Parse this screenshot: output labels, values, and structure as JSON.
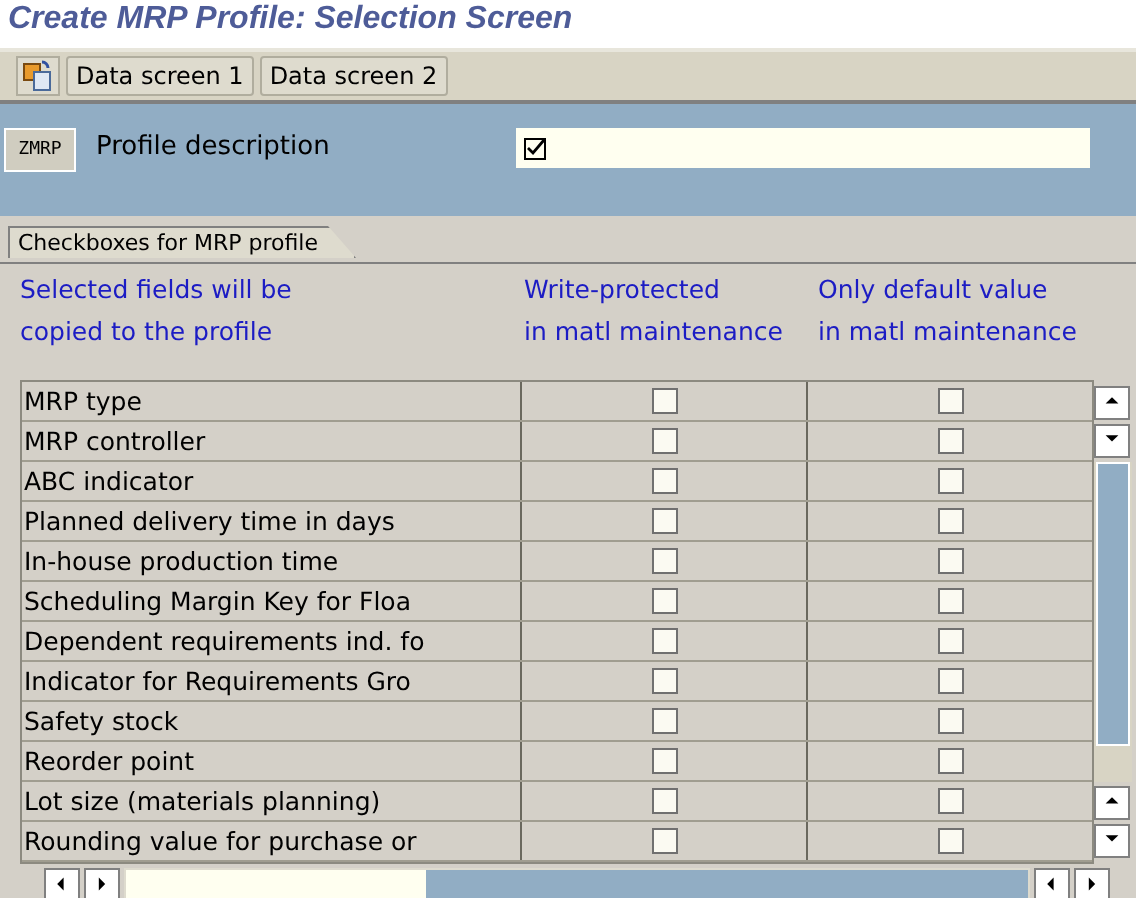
{
  "title": "Create MRP Profile: Selection Screen",
  "toolbar": {
    "buttons": [
      "Data screen 1",
      "Data screen 2"
    ]
  },
  "profile": {
    "code": "ZMRP",
    "label": "Profile description"
  },
  "tab": {
    "label": "Checkboxes for MRP profile",
    "selected": true
  },
  "headers": [
    {
      "line1": "Selected fields will be",
      "line2": "copied to the profile"
    },
    {
      "line1": "Write-protected",
      "line2": "in matl maintenance"
    },
    {
      "line1": "Only default value",
      "line2": "in matl maintenance"
    }
  ],
  "rows": [
    {
      "label": "MRP type",
      "write_protected": false,
      "default_only": false
    },
    {
      "label": "MRP controller",
      "write_protected": false,
      "default_only": false
    },
    {
      "label": "ABC indicator",
      "write_protected": false,
      "default_only": false
    },
    {
      "label": "Planned delivery time in days",
      "write_protected": false,
      "default_only": false
    },
    {
      "label": "In-house production time",
      "write_protected": false,
      "default_only": false
    },
    {
      "label": "Scheduling Margin Key for Floa",
      "write_protected": false,
      "default_only": false
    },
    {
      "label": "Dependent requirements ind. fo",
      "write_protected": false,
      "default_only": false
    },
    {
      "label": "Indicator for Requirements Gro",
      "write_protected": false,
      "default_only": false
    },
    {
      "label": "Safety stock",
      "write_protected": false,
      "default_only": false
    },
    {
      "label": "Reorder point",
      "write_protected": false,
      "default_only": false
    },
    {
      "label": "Lot size (materials planning)",
      "write_protected": false,
      "default_only": false
    },
    {
      "label": "Rounding value for purchase or",
      "write_protected": false,
      "default_only": false
    }
  ]
}
